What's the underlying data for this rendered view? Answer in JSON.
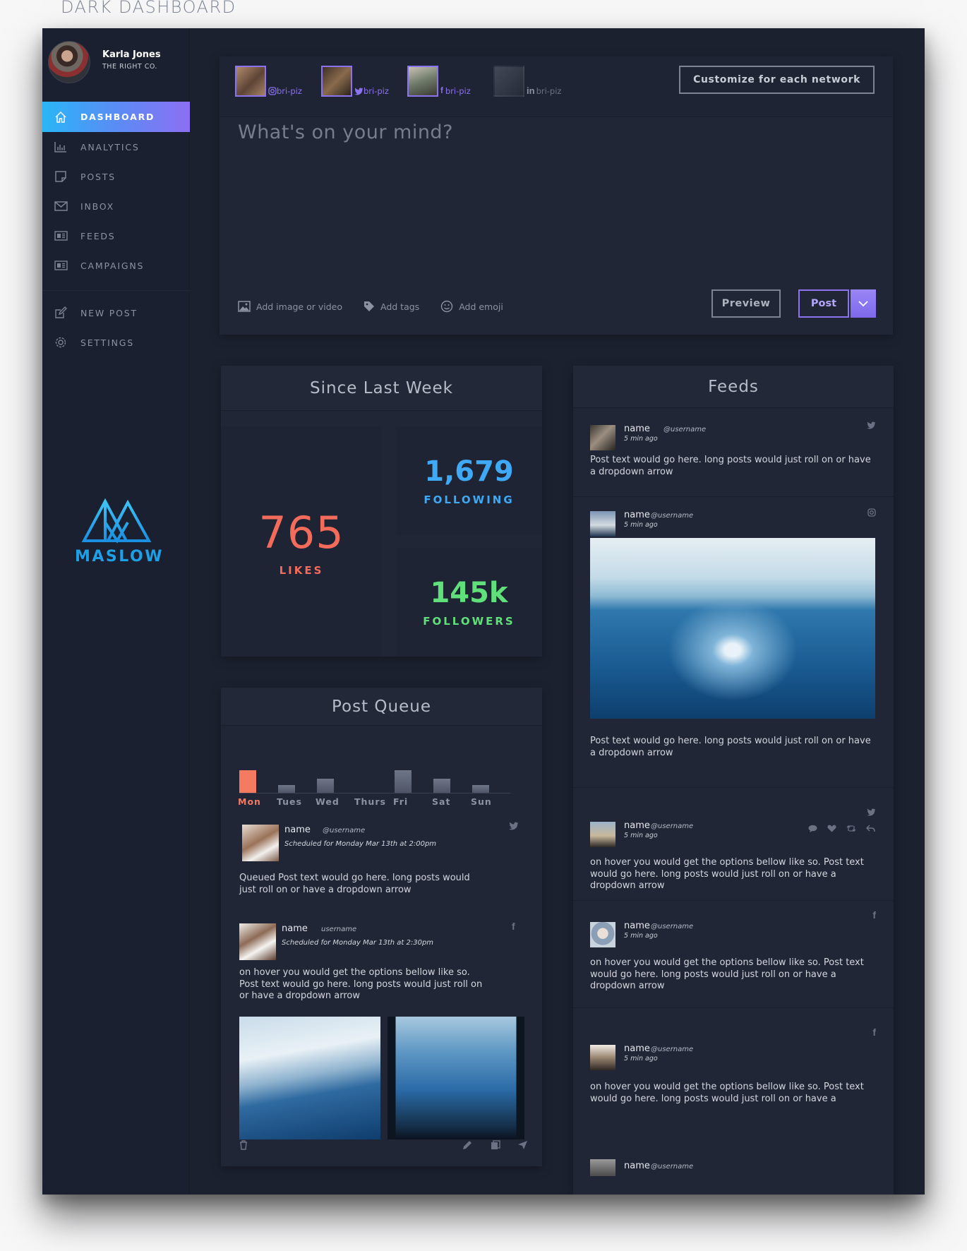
{
  "page_heading": "DARK DASHBOARD",
  "profile": {
    "name": "Karla Jones",
    "company": "THE RIGHT CO."
  },
  "nav": {
    "items": [
      {
        "label": "DASHBOARD",
        "icon": "home-icon",
        "active": true
      },
      {
        "label": "ANALYTICS",
        "icon": "bar-chart-icon"
      },
      {
        "label": "POSTS",
        "icon": "note-icon"
      },
      {
        "label": "INBOX",
        "icon": "envelope-icon"
      },
      {
        "label": "FEEDS",
        "icon": "newspaper-icon"
      },
      {
        "label": "CAMPAIGNS",
        "icon": "newspaper-icon"
      }
    ],
    "secondary": [
      {
        "label": "NEW POST",
        "icon": "edit-icon"
      },
      {
        "label": "SETTINGS",
        "icon": "gear-icon"
      }
    ]
  },
  "logo": {
    "word": "MASLOW"
  },
  "composer": {
    "accounts": [
      {
        "network": "instagram",
        "handle": "bri-piz",
        "selected": true
      },
      {
        "network": "twitter",
        "handle": "bri-piz",
        "selected": true
      },
      {
        "network": "facebook",
        "handle": "bri-piz",
        "selected": true
      },
      {
        "network": "linkedin",
        "handle": "bri-piz",
        "selected": false
      }
    ],
    "customize_label": "Customize for each network",
    "placeholder": "What's on your mind?",
    "tools": {
      "image": "Add image or video",
      "tags": "Add tags",
      "emoji": "Add emoji"
    },
    "preview_label": "Preview",
    "post_label": "Post"
  },
  "stats": {
    "title": "Since Last Week",
    "likes": {
      "value": "765",
      "label": "LIKES"
    },
    "following": {
      "value": "1,679",
      "label": "FOLLOWING"
    },
    "followers": {
      "value": "145k",
      "label": "FOLLOWERS"
    },
    "colors": {
      "likes": "#f26b5b",
      "following": "#3fa9f5",
      "followers": "#5fe07a"
    }
  },
  "queue": {
    "title": "Post Queue",
    "days": [
      {
        "label": "Mon",
        "level": 1.0,
        "today": true
      },
      {
        "label": "Tues",
        "level": 0.33
      },
      {
        "label": "Wed",
        "level": 0.62
      },
      {
        "label": "Thurs",
        "level": 0.0
      },
      {
        "label": "Fri",
        "level": 1.0
      },
      {
        "label": "Sat",
        "level": 0.62
      },
      {
        "label": "Sun",
        "level": 0.33
      }
    ],
    "items": [
      {
        "name": "name",
        "username": "@username",
        "scheduled": "Scheduled for Monday Mar 13th at 2:00pm",
        "network": "twitter",
        "text": "Queued Post text would go here. long posts would just roll on or have a dropdown arrow"
      },
      {
        "name": "name",
        "username": "username",
        "scheduled": "Scheduled for Monday Mar 13th at 2:30pm",
        "network": "facebook",
        "text": "on hover you would get the options bellow like so. Post text would go here. long posts would just roll on or have a dropdown arrow"
      }
    ],
    "actions": [
      "trash-icon",
      "pencil-icon",
      "copy-icon",
      "send-icon"
    ]
  },
  "feeds": {
    "title": "Feeds",
    "items": [
      {
        "name": "name",
        "username": "@username",
        "ago": "5 min ago",
        "network": "twitter",
        "text": "Post text would go here. long posts would just roll on or have a dropdown arrow"
      },
      {
        "name": "name",
        "username": "@username",
        "ago": "5 min ago",
        "network": "instagram",
        "text": "Post text would go here. long posts would just roll on or have a dropdown arrow"
      },
      {
        "name": "name",
        "username": "@username",
        "ago": "5 min ago",
        "network": "twitter",
        "text": "on hover you would get the options bellow like so. Post text would go here. long posts would just roll on or have a dropdown arrow"
      },
      {
        "name": "name",
        "username": "@username",
        "ago": "5 min ago",
        "network": "facebook",
        "text": "on hover you would get the options bellow like so. Post text would go here. long posts would just roll on or have a dropdown arrow"
      },
      {
        "name": "name",
        "username": "@username",
        "ago": "5 min ago",
        "network": "facebook",
        "text": "on hover you would get the options bellow like so. Post text would go here. long posts would just roll on or have a"
      },
      {
        "name": "name",
        "username": "@username"
      }
    ],
    "hover_actions": [
      "comment-icon",
      "heart-icon",
      "retweet-icon",
      "reply-icon"
    ]
  }
}
